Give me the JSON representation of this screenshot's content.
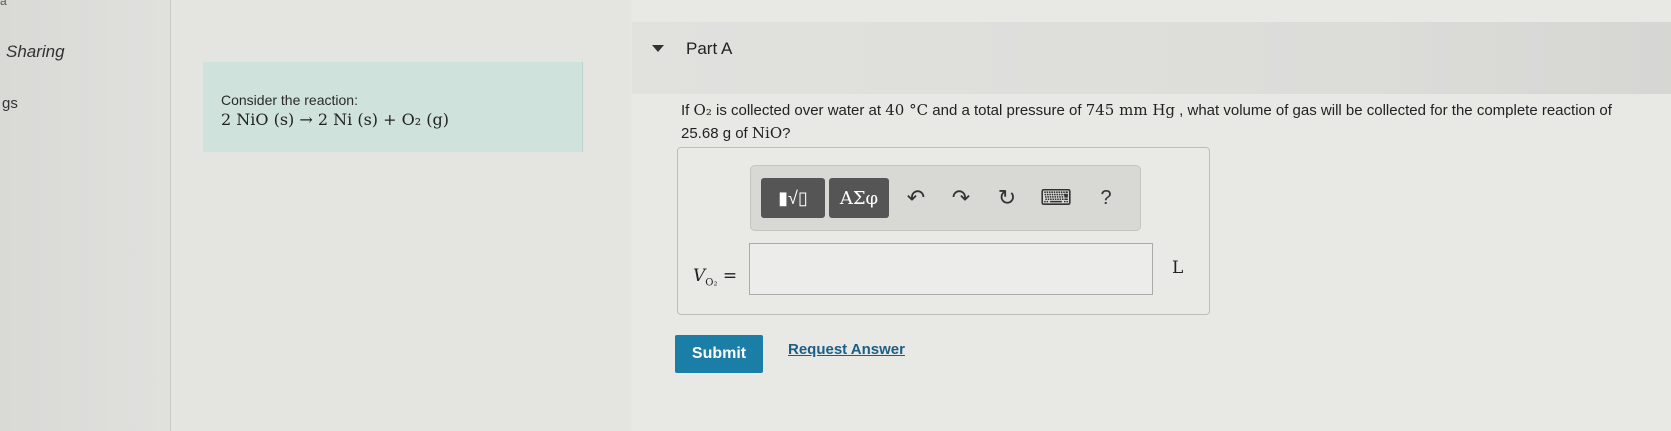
{
  "sidebar": {
    "top_letter": "a",
    "items": [
      {
        "label": "Sharing"
      },
      {
        "label": "gs"
      }
    ]
  },
  "reaction": {
    "label": "Consider the reaction:",
    "equation": "2 NiO (s) → 2 Ni (s) + O₂ (g)"
  },
  "part": {
    "title": "Part A"
  },
  "question": {
    "prefix": "If ",
    "gas": "O₂",
    "text1": " is collected over water at ",
    "temperature": "40 °C",
    "text2": " and a total pressure of ",
    "pressure": "745 mm Hg",
    "text3": " , what volume of gas will be collected for the complete reaction of ",
    "mass": "25.68 g",
    "text4": " of ",
    "compound": "NiO",
    "text5": "?"
  },
  "toolbar": {
    "templates_label": "▮√▯",
    "greek_label": "ΑΣφ",
    "undo_glyph": "↶",
    "redo_glyph": "↷",
    "reset_glyph": "↻",
    "keyboard_glyph": "⌨",
    "help_label": "?"
  },
  "answer": {
    "variable": "V",
    "subscript": "O₂",
    "equals": "=",
    "value": "",
    "unit": "L"
  },
  "actions": {
    "submit_label": "Submit",
    "request_answer_label": "Request Answer"
  },
  "colors": {
    "reaction_bg": "#cfe2dc",
    "submit_bg": "#1a7ea6",
    "link": "#1b5f86"
  }
}
